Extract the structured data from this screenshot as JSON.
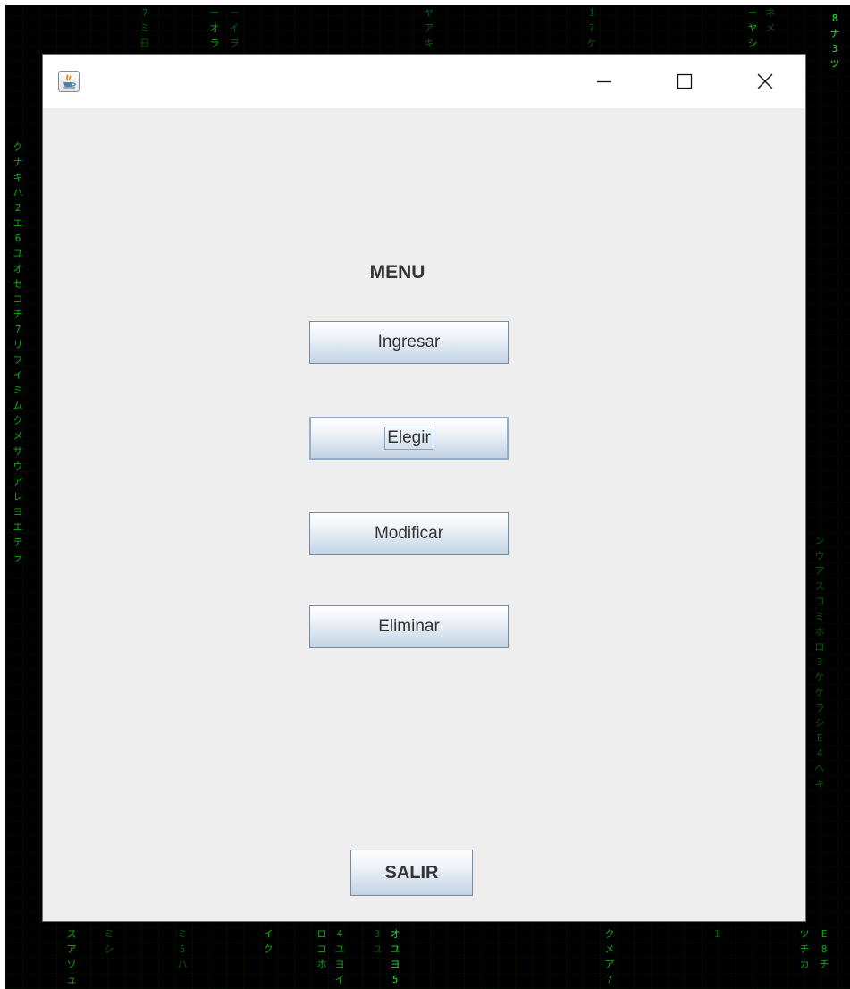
{
  "window": {
    "icon": "java-coffee-cup-icon",
    "controls": {
      "minimize": "minimize-icon",
      "maximize": "maximize-icon",
      "close": "close-icon"
    }
  },
  "menu": {
    "title": "MENU",
    "buttons": [
      {
        "label": "Ingresar"
      },
      {
        "label": "Elegir",
        "focused": true
      },
      {
        "label": "Modificar"
      },
      {
        "label": "Eliminar"
      }
    ],
    "exit_label": "SALIR"
  },
  "colors": {
    "window_background": "#eeeeee",
    "titlebar_background": "#ffffff",
    "button_border": "#7a8a99",
    "focused_border": "#93aecb",
    "desktop_background": "#000000",
    "desktop_glyphs": "#22e622"
  }
}
